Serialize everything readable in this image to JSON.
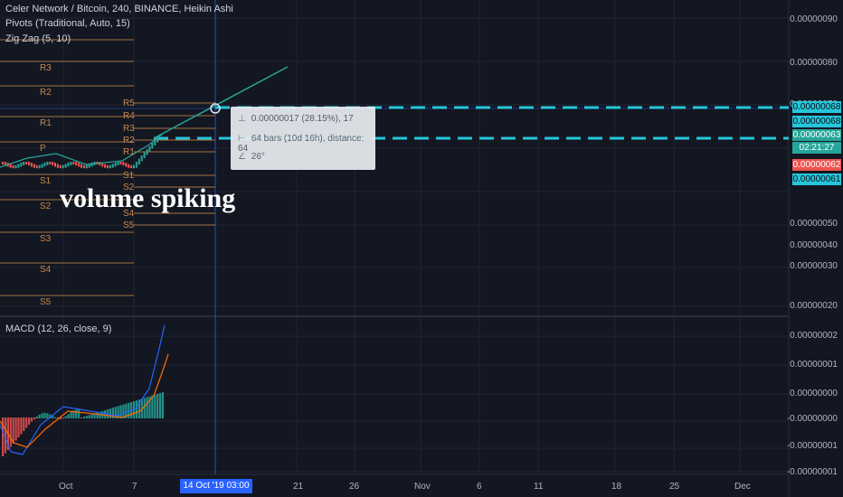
{
  "legend": {
    "title": "Celer Network / Bitcoin, 240, BINANCE, Heikin Ashi",
    "pivots": "Pivots (Traditional, Auto, 15)",
    "zigzag": "Zig Zag (5, 10)",
    "macd": "MACD (12, 26, close, 9)"
  },
  "pivot_levels_left": [
    "R3",
    "R2",
    "R1",
    "P",
    "S1",
    "S2",
    "S3",
    "S4",
    "S5"
  ],
  "pivot_levels_right": [
    "R5",
    "R4",
    "R3",
    "R2",
    "R1",
    "S1",
    "S2",
    "S4",
    "S5"
  ],
  "y_axis_main": [
    "0.00000090",
    "0.00000080",
    "0.00000070",
    "0.00000050",
    "0.00000040",
    "0.00000030",
    "0.00000020"
  ],
  "y_axis_macd": [
    "0.00000002",
    "0.00000001",
    "0.00000000",
    "-0.00000000",
    "-0.00000001",
    "-0.00000001"
  ],
  "x_axis": [
    "Oct",
    "7",
    "21",
    "26",
    "Nov",
    "6",
    "11",
    "18",
    "25",
    "Dec"
  ],
  "x_axis_highlight": "14 Oct '19   03:00",
  "price_badges": [
    {
      "text": "0.00000068",
      "color": "#26c6da"
    },
    {
      "text": "0.00000068",
      "color": "#26c6da"
    },
    {
      "text": "0.00000063",
      "color": "#26a69a"
    },
    {
      "text": "02:21:27",
      "color": "#26a69a"
    },
    {
      "text": "0.00000062",
      "color": "#ef5350"
    },
    {
      "text": "0.00000061",
      "color": "#26c6da"
    }
  ],
  "tooltip": {
    "price_range": "0.00000017 (28.15%), 17",
    "bars": "64 bars (10d 16h), distance: 64",
    "angle": "26°",
    "range_icon": "ruler-vertical-icon",
    "bars_icon": "ruler-horizontal-icon",
    "angle_icon": "angle-icon"
  },
  "annotation": "volume spiking",
  "colors": {
    "background": "#131722",
    "grid": "#1f2433",
    "pivot": "#c98a4b",
    "dashed_lines": "#26c6da",
    "trendline": "#26a69a",
    "candle_up": "#26a69a",
    "candle_down": "#ef5350",
    "macd": "#2962ff",
    "signal": "#ff6d00"
  }
}
